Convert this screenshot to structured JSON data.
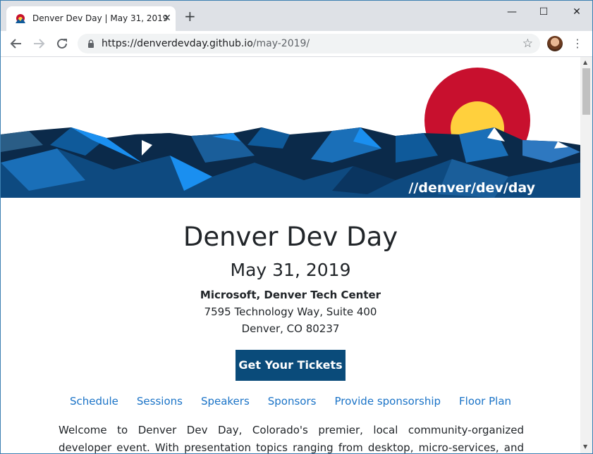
{
  "browser": {
    "tab_title": "Denver Dev Day | May 31, 2019",
    "tab_close": "✕",
    "new_tab": "+",
    "url_host": "https://denverdevday.github.io",
    "url_path": "/may-2019/",
    "window_min": "—",
    "window_max": "☐",
    "window_close": "✕"
  },
  "banner": {
    "tagline": "//denver/dev/day",
    "colors": {
      "sky": "#ffffff",
      "sun_red": "#c8102e",
      "sun_gold": "#ffd03d",
      "mountain_dark": "#0b2a4a",
      "mountain_mid": "#0f5a9a",
      "mountain_light": "#1a8ff0"
    }
  },
  "event": {
    "title": "Denver Dev Day",
    "date": "May 31, 2019",
    "venue": "Microsoft, Denver Tech Center",
    "address_line1": "7595 Technology Way, Suite 400",
    "address_line2": "Denver, CO 80237",
    "cta_label": "Get Your Tickets"
  },
  "nav": {
    "links": [
      "Schedule",
      "Sessions",
      "Speakers",
      "Sponsors",
      "Provide sponsorship",
      "Floor Plan"
    ]
  },
  "intro": {
    "text": "Welcome to Denver Dev Day, Colorado's premier, local community-organized developer event. With presentation topics ranging from desktop, micro-services, and web development"
  },
  "colors": {
    "accent": "#0a4b7a",
    "link": "#1a73c7"
  }
}
